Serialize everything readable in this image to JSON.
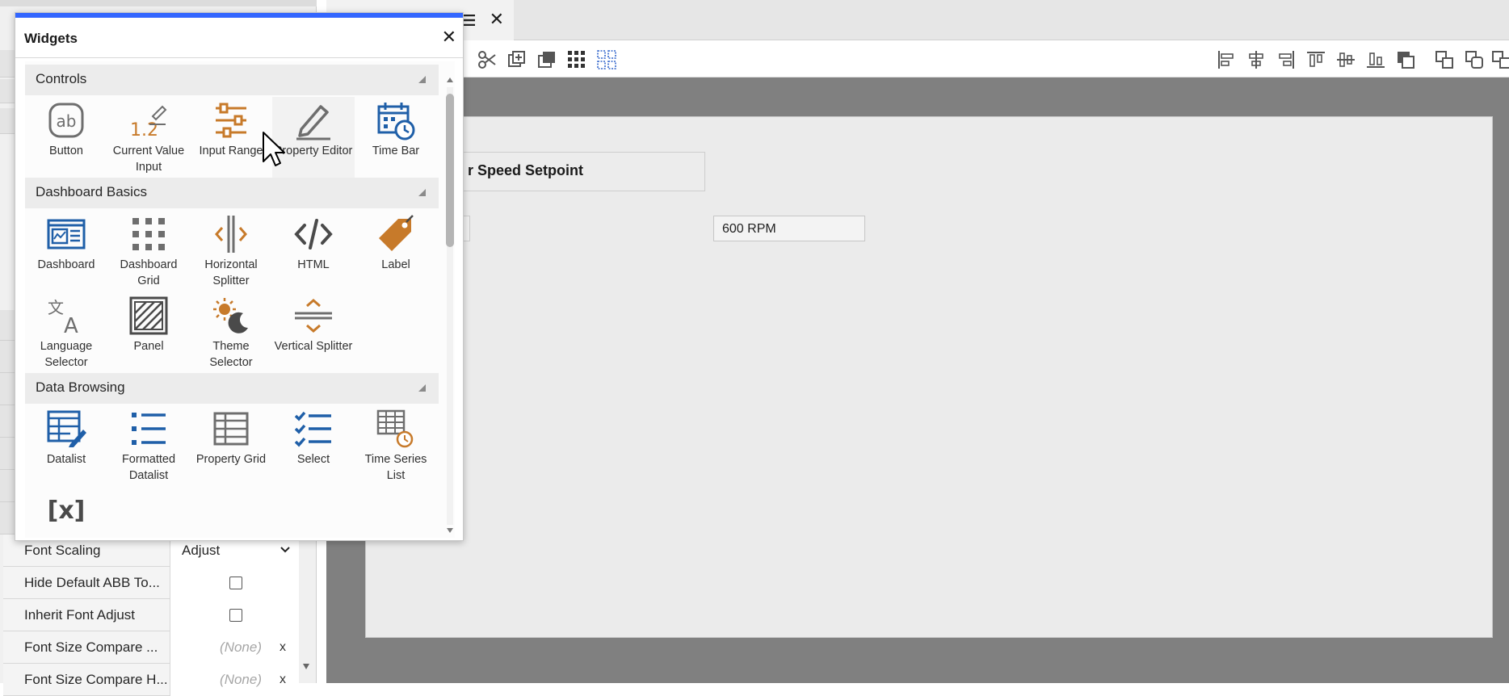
{
  "dialog": {
    "title": "Widgets",
    "sections": [
      {
        "label": "Controls",
        "widgets": [
          {
            "label": "Button",
            "icon": "button-icon"
          },
          {
            "label": "Current Value Input",
            "icon": "current-value-input-icon"
          },
          {
            "label": "Input Range",
            "icon": "input-range-icon"
          },
          {
            "label": "Property Editor",
            "icon": "property-editor-icon"
          },
          {
            "label": "Time Bar",
            "icon": "time-bar-icon"
          }
        ]
      },
      {
        "label": "Dashboard Basics",
        "widgets": [
          {
            "label": "Dashboard",
            "icon": "dashboard-icon"
          },
          {
            "label": "Dashboard Grid",
            "icon": "dashboard-grid-icon"
          },
          {
            "label": "Horizontal Splitter",
            "icon": "horizontal-splitter-icon"
          },
          {
            "label": "HTML",
            "icon": "html-icon"
          },
          {
            "label": "Label",
            "icon": "label-icon"
          },
          {
            "label": "Language Selector",
            "icon": "language-selector-icon"
          },
          {
            "label": "Panel",
            "icon": "panel-icon"
          },
          {
            "label": "Theme Selector",
            "icon": "theme-selector-icon"
          },
          {
            "label": "Vertical Splitter",
            "icon": "vertical-splitter-icon"
          }
        ]
      },
      {
        "label": "Data Browsing",
        "widgets": [
          {
            "label": "Datalist",
            "icon": "datalist-icon"
          },
          {
            "label": "Formatted Datalist",
            "icon": "formatted-datalist-icon"
          },
          {
            "label": "Property Grid",
            "icon": "property-grid-icon"
          },
          {
            "label": "Select",
            "icon": "select-icon"
          },
          {
            "label": "Time Series List",
            "icon": "time-series-list-icon"
          },
          {
            "label": "",
            "icon": "variable-icon"
          }
        ]
      }
    ]
  },
  "properties": [
    {
      "name": "Font Scaling",
      "type": "select",
      "value": "Adjust"
    },
    {
      "name": "Hide Default ABB To...",
      "type": "checkbox",
      "checked": false
    },
    {
      "name": "Inherit Font Adjust",
      "type": "checkbox",
      "checked": false
    },
    {
      "name": "Font Size Compare ...",
      "type": "none",
      "value": "(None)",
      "clear": "x"
    },
    {
      "name": "Font Size Compare H...",
      "type": "none",
      "value": "(None)",
      "clear": "x"
    }
  ],
  "canvas": {
    "title": "r Speed Setpoint",
    "value": "600 RPM"
  },
  "colors": {
    "accent": "#3366ff",
    "icon_gray": "#6e6e6e",
    "icon_blue": "#1f5fa8",
    "icon_orange": "#c77a2a",
    "canvas_bg": "#808080"
  }
}
